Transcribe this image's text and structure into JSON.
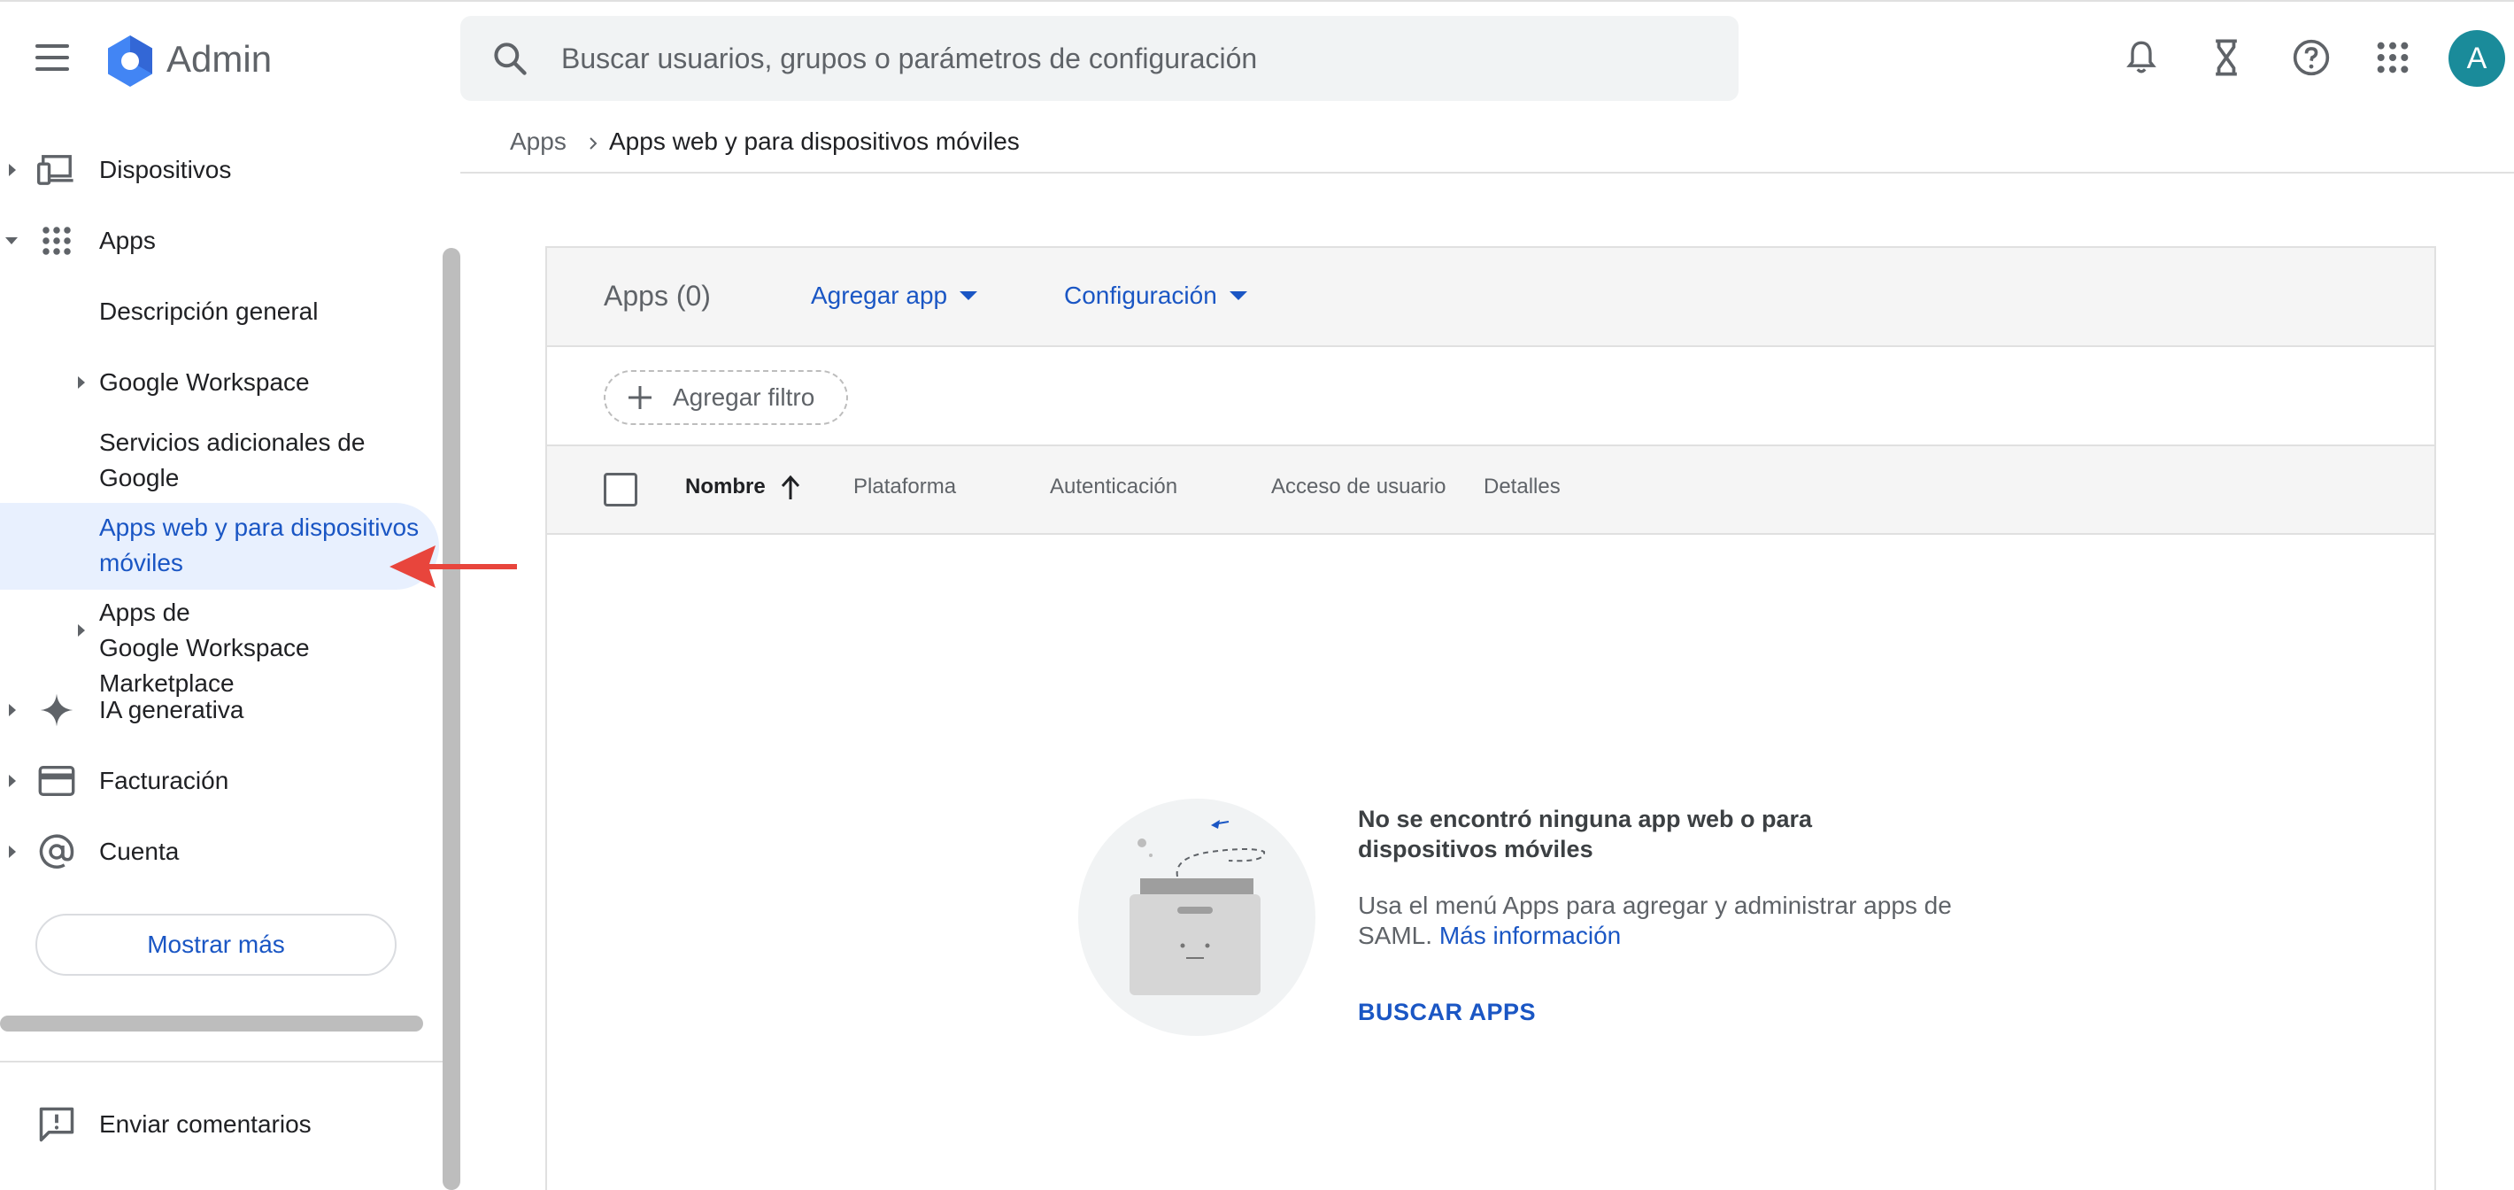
{
  "header": {
    "app_title": "Admin",
    "search_placeholder": "Buscar usuarios, grupos o parámetros de configuración",
    "avatar_initial": "A",
    "icons": [
      "menu-icon",
      "admin-logo",
      "search-icon",
      "notifications-icon",
      "hourglass-icon",
      "help-icon",
      "apps-grid-icon"
    ]
  },
  "sidebar": {
    "items": [
      {
        "label": "Dispositivos",
        "icon": "devices-icon",
        "expanded": false
      },
      {
        "label": "Apps",
        "icon": "apps-grid-icon",
        "expanded": true
      },
      {
        "label": "Descripción general"
      },
      {
        "label": "Google Workspace",
        "expandable": true
      },
      {
        "label": "Servicios adicionales de Google"
      },
      {
        "label": "Apps web y para dispositivos móviles",
        "active": true
      },
      {
        "label": "Apps de Google Workspace Marketplace",
        "expandable": true
      },
      {
        "label": "IA generativa",
        "icon": "sparkle-icon",
        "expanded": false
      },
      {
        "label": "Facturación",
        "icon": "credit-card-icon",
        "expanded": false
      },
      {
        "label": "Cuenta",
        "icon": "at-sign-icon",
        "expanded": false
      }
    ],
    "sub_gw_line1": "Apps de",
    "sub_gw_line2": "Google Workspace Marketplace",
    "more_button": "Mostrar más",
    "feedback": "Enviar comentarios"
  },
  "breadcrumb": {
    "parent": "Apps",
    "current": "Apps web y para dispositivos móviles"
  },
  "toolbar": {
    "title": "Apps (0)",
    "add_app": "Agregar app",
    "settings": "Configuración"
  },
  "filter": {
    "add_filter": "Agregar filtro"
  },
  "table": {
    "columns": [
      "Nombre",
      "Plataforma",
      "Autenticación",
      "Acceso de usuario",
      "Detalles"
    ],
    "sorted_column": "Nombre",
    "sort_direction": "ascending"
  },
  "empty_state": {
    "title": "No se encontró ninguna app web o para dispositivos móviles",
    "description": "Usa el menú Apps para agregar y administrar apps de SAML.",
    "link": "Más información",
    "button": "BUSCAR APPS"
  },
  "colors": {
    "accent": "#1a56c4",
    "active_bg": "#e8f0fe",
    "avatar": "#1a8b9a",
    "annotation_arrow": "#e8453c"
  }
}
